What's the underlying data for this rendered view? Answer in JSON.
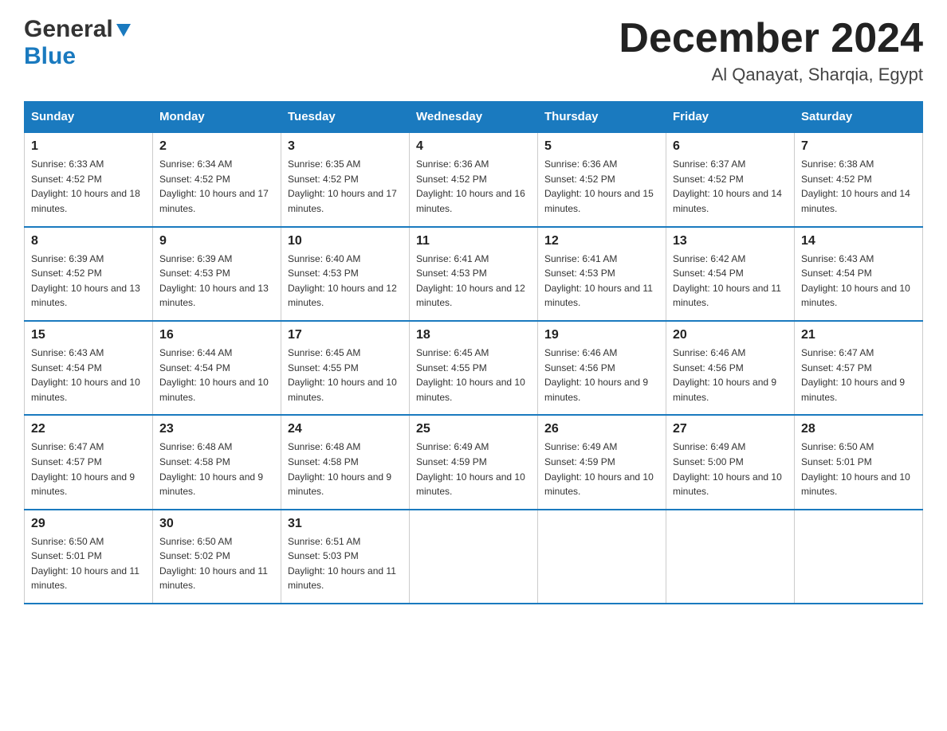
{
  "header": {
    "logo": {
      "general": "General",
      "blue": "Blue"
    },
    "title": "December 2024",
    "subtitle": "Al Qanayat, Sharqia, Egypt"
  },
  "columns": [
    "Sunday",
    "Monday",
    "Tuesday",
    "Wednesday",
    "Thursday",
    "Friday",
    "Saturday"
  ],
  "weeks": [
    [
      {
        "day": "1",
        "sunrise": "6:33 AM",
        "sunset": "4:52 PM",
        "daylight": "10 hours and 18 minutes."
      },
      {
        "day": "2",
        "sunrise": "6:34 AM",
        "sunset": "4:52 PM",
        "daylight": "10 hours and 17 minutes."
      },
      {
        "day": "3",
        "sunrise": "6:35 AM",
        "sunset": "4:52 PM",
        "daylight": "10 hours and 17 minutes."
      },
      {
        "day": "4",
        "sunrise": "6:36 AM",
        "sunset": "4:52 PM",
        "daylight": "10 hours and 16 minutes."
      },
      {
        "day": "5",
        "sunrise": "6:36 AM",
        "sunset": "4:52 PM",
        "daylight": "10 hours and 15 minutes."
      },
      {
        "day": "6",
        "sunrise": "6:37 AM",
        "sunset": "4:52 PM",
        "daylight": "10 hours and 14 minutes."
      },
      {
        "day": "7",
        "sunrise": "6:38 AM",
        "sunset": "4:52 PM",
        "daylight": "10 hours and 14 minutes."
      }
    ],
    [
      {
        "day": "8",
        "sunrise": "6:39 AM",
        "sunset": "4:52 PM",
        "daylight": "10 hours and 13 minutes."
      },
      {
        "day": "9",
        "sunrise": "6:39 AM",
        "sunset": "4:53 PM",
        "daylight": "10 hours and 13 minutes."
      },
      {
        "day": "10",
        "sunrise": "6:40 AM",
        "sunset": "4:53 PM",
        "daylight": "10 hours and 12 minutes."
      },
      {
        "day": "11",
        "sunrise": "6:41 AM",
        "sunset": "4:53 PM",
        "daylight": "10 hours and 12 minutes."
      },
      {
        "day": "12",
        "sunrise": "6:41 AM",
        "sunset": "4:53 PM",
        "daylight": "10 hours and 11 minutes."
      },
      {
        "day": "13",
        "sunrise": "6:42 AM",
        "sunset": "4:54 PM",
        "daylight": "10 hours and 11 minutes."
      },
      {
        "day": "14",
        "sunrise": "6:43 AM",
        "sunset": "4:54 PM",
        "daylight": "10 hours and 10 minutes."
      }
    ],
    [
      {
        "day": "15",
        "sunrise": "6:43 AM",
        "sunset": "4:54 PM",
        "daylight": "10 hours and 10 minutes."
      },
      {
        "day": "16",
        "sunrise": "6:44 AM",
        "sunset": "4:54 PM",
        "daylight": "10 hours and 10 minutes."
      },
      {
        "day": "17",
        "sunrise": "6:45 AM",
        "sunset": "4:55 PM",
        "daylight": "10 hours and 10 minutes."
      },
      {
        "day": "18",
        "sunrise": "6:45 AM",
        "sunset": "4:55 PM",
        "daylight": "10 hours and 10 minutes."
      },
      {
        "day": "19",
        "sunrise": "6:46 AM",
        "sunset": "4:56 PM",
        "daylight": "10 hours and 9 minutes."
      },
      {
        "day": "20",
        "sunrise": "6:46 AM",
        "sunset": "4:56 PM",
        "daylight": "10 hours and 9 minutes."
      },
      {
        "day": "21",
        "sunrise": "6:47 AM",
        "sunset": "4:57 PM",
        "daylight": "10 hours and 9 minutes."
      }
    ],
    [
      {
        "day": "22",
        "sunrise": "6:47 AM",
        "sunset": "4:57 PM",
        "daylight": "10 hours and 9 minutes."
      },
      {
        "day": "23",
        "sunrise": "6:48 AM",
        "sunset": "4:58 PM",
        "daylight": "10 hours and 9 minutes."
      },
      {
        "day": "24",
        "sunrise": "6:48 AM",
        "sunset": "4:58 PM",
        "daylight": "10 hours and 9 minutes."
      },
      {
        "day": "25",
        "sunrise": "6:49 AM",
        "sunset": "4:59 PM",
        "daylight": "10 hours and 10 minutes."
      },
      {
        "day": "26",
        "sunrise": "6:49 AM",
        "sunset": "4:59 PM",
        "daylight": "10 hours and 10 minutes."
      },
      {
        "day": "27",
        "sunrise": "6:49 AM",
        "sunset": "5:00 PM",
        "daylight": "10 hours and 10 minutes."
      },
      {
        "day": "28",
        "sunrise": "6:50 AM",
        "sunset": "5:01 PM",
        "daylight": "10 hours and 10 minutes."
      }
    ],
    [
      {
        "day": "29",
        "sunrise": "6:50 AM",
        "sunset": "5:01 PM",
        "daylight": "10 hours and 11 minutes."
      },
      {
        "day": "30",
        "sunrise": "6:50 AM",
        "sunset": "5:02 PM",
        "daylight": "10 hours and 11 minutes."
      },
      {
        "day": "31",
        "sunrise": "6:51 AM",
        "sunset": "5:03 PM",
        "daylight": "10 hours and 11 minutes."
      },
      null,
      null,
      null,
      null
    ]
  ]
}
